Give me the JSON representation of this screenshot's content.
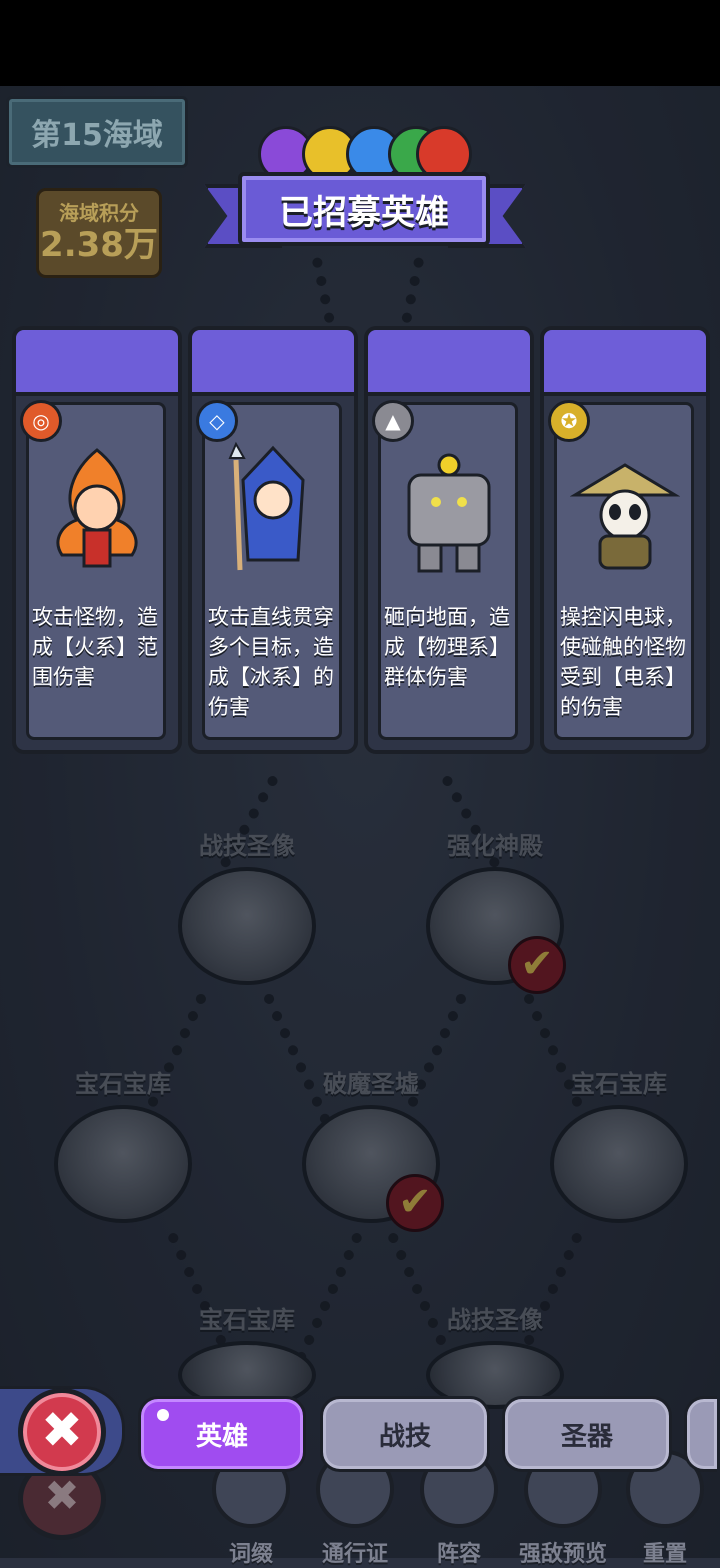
{
  "zone": {
    "title": "第15海域"
  },
  "score": {
    "label": "海域积分",
    "value": "2.38万"
  },
  "popup": {
    "title": "已招募英雄",
    "element_orbs": [
      "violet-orb",
      "lightning-orb",
      "ice-orb",
      "wind-orb",
      "fire-orb"
    ],
    "colors": {
      "violet": "#8a4ad8",
      "lightning": "#e8c02a",
      "ice": "#3a8ae8",
      "wind": "#3aa84a",
      "fire": "#d83a2a"
    }
  },
  "heroes": [
    {
      "element": "fire-element-icon",
      "element_color": "#e05a2a",
      "art": "fire-spirit",
      "description": "攻击怪物，造成【火系】范围伤害"
    },
    {
      "element": "ice-element-icon",
      "element_color": "#3a7ae0",
      "art": "ice-mage",
      "description": "攻击直线贯穿多个目标，造成【冰系】的伤害"
    },
    {
      "element": "physical-element-icon",
      "element_color": "#8a8a92",
      "art": "rock-golem",
      "description": "砸向地面，造成【物理系】群体伤害"
    },
    {
      "element": "electric-element-icon",
      "element_color": "#d8b02a",
      "art": "panda-monk",
      "description": "操控闪电球，使碰触的怪物受到【电系】的伤害"
    }
  ],
  "map_nodes": [
    {
      "label": "战技圣像",
      "completed": false
    },
    {
      "label": "强化神殿",
      "completed": true
    },
    {
      "label": "宝石宝库",
      "completed": false
    },
    {
      "label": "破魔圣墟",
      "completed": true
    },
    {
      "label": "宝石宝库",
      "completed": false
    },
    {
      "label": "宝石宝库",
      "completed": false
    },
    {
      "label": "战技圣像",
      "completed": false
    }
  ],
  "bottom_nav": [
    {
      "label": "词缀",
      "icon": "book-icon"
    },
    {
      "label": "通行证",
      "icon": "passport-icon"
    },
    {
      "label": "阵容",
      "icon": "lineup-icon"
    },
    {
      "label": "强敌预览",
      "icon": "magnifier-icon"
    },
    {
      "label": "重置",
      "icon": "reset-icon"
    }
  ],
  "tabs": [
    {
      "label": "英雄",
      "active": true
    },
    {
      "label": "战技",
      "active": false
    },
    {
      "label": "圣器",
      "active": false
    }
  ],
  "close_label": "✖"
}
